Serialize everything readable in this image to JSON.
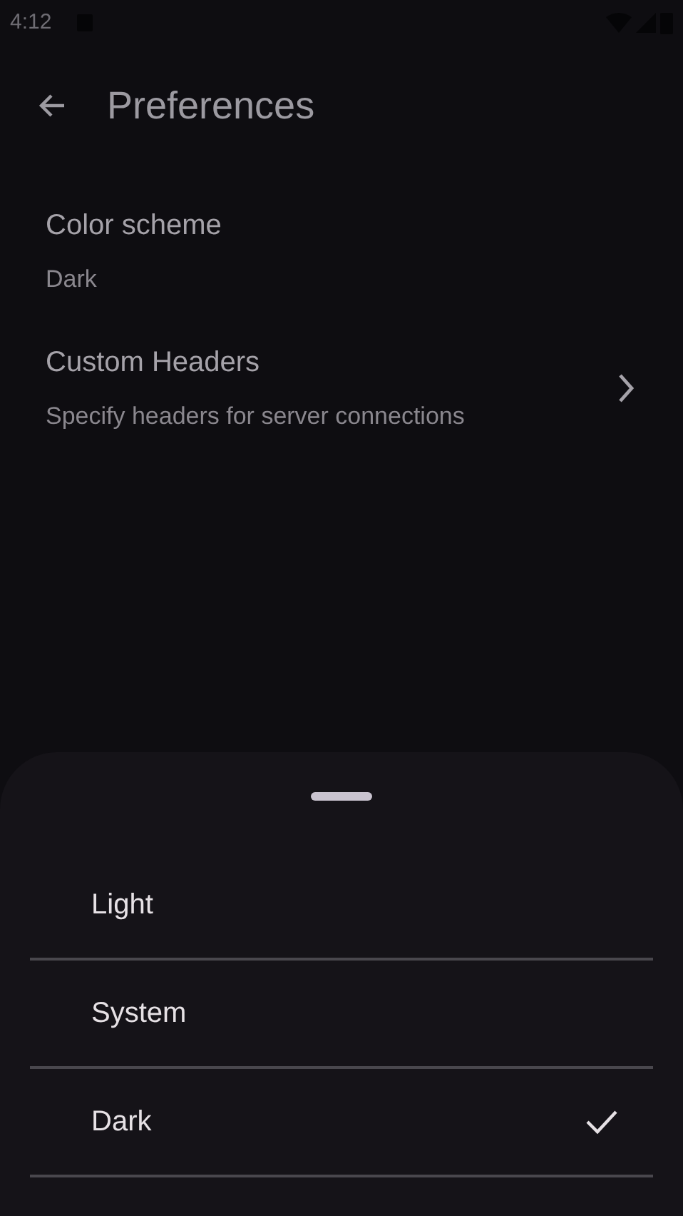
{
  "status_bar": {
    "time": "4:12"
  },
  "app_bar": {
    "title": "Preferences"
  },
  "preferences": [
    {
      "kind": "value",
      "title": "Color scheme",
      "summary": "Dark"
    },
    {
      "kind": "link",
      "title": "Custom Headers",
      "summary": "Specify headers for server connections"
    }
  ],
  "sheet": {
    "options": [
      {
        "label": "Light",
        "selected": false
      },
      {
        "label": "System",
        "selected": false
      },
      {
        "label": "Dark",
        "selected": true
      }
    ]
  }
}
